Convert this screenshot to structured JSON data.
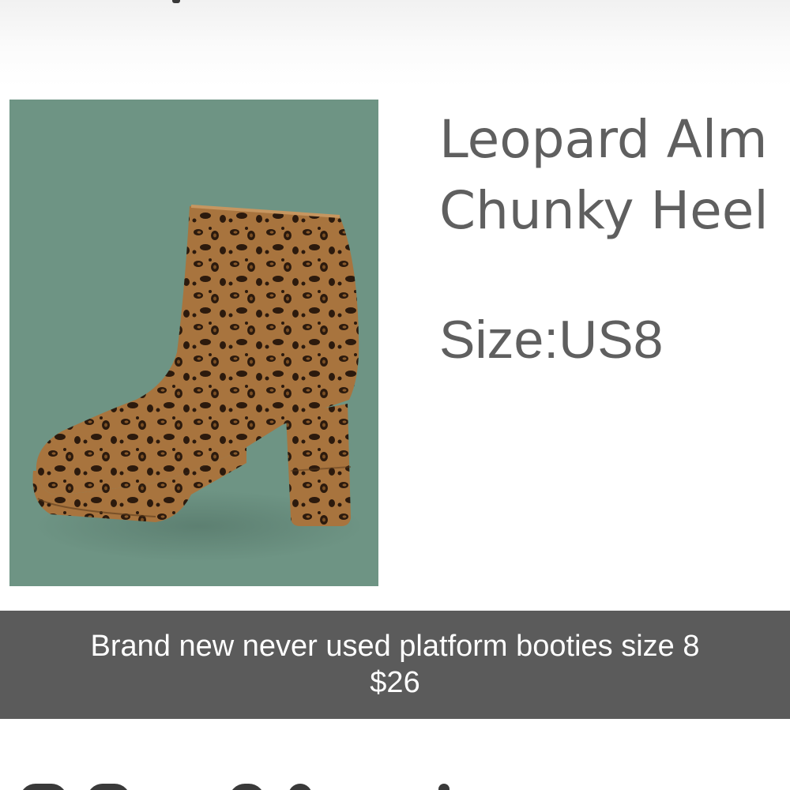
{
  "product": {
    "title_line1": "Leopard Alm",
    "title_line2": "Chunky Heel",
    "size": "Size:US8",
    "image_icon": "leopard-platform-bootie-photo"
  },
  "caption": {
    "line1": "Brand new never used platform booties size 8",
    "line2": "$26"
  },
  "colors": {
    "image_background": "#6e9484",
    "title_text": "#5f5f5f",
    "caption_bar": "#525252",
    "caption_text": "#ffffff"
  }
}
